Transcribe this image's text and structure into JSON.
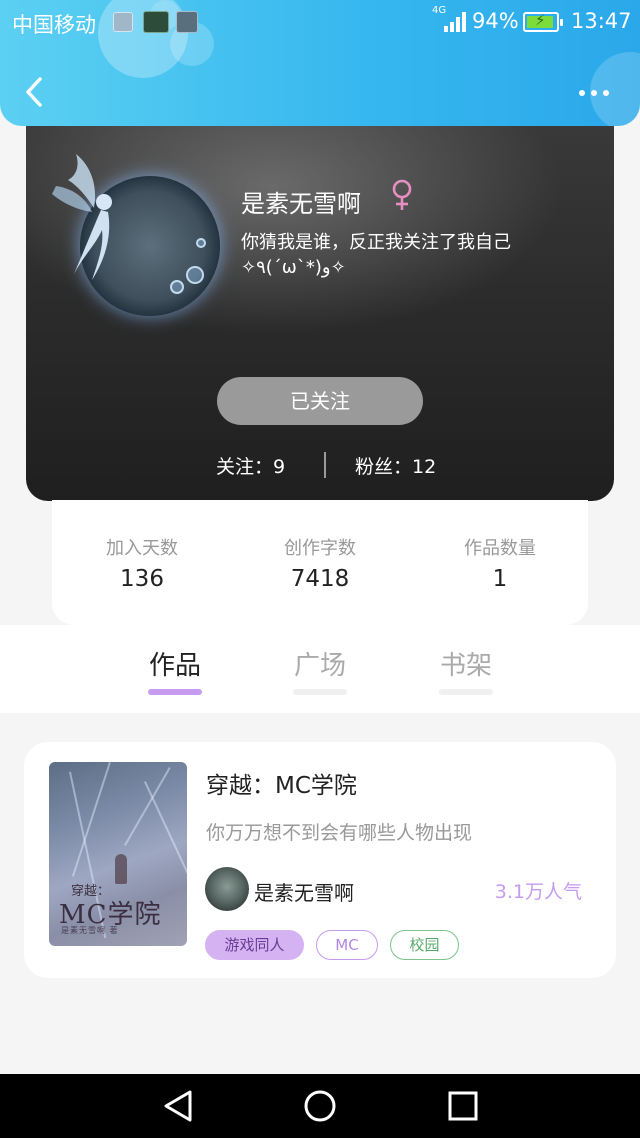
{
  "status_bar": {
    "carrier": "中国移动",
    "network": "4G",
    "battery": "94%",
    "battery_level": 0.94,
    "time": "13:47"
  },
  "header": {
    "back_icon": "chevron-left-icon",
    "more_icon": "more-horizontal-icon"
  },
  "profile": {
    "username": "是素无雪啊",
    "gender_icon": "female-icon",
    "bio": "你猜我是谁，反正我关注了我自己✧٩(ˊωˋ*)و✧",
    "follow_button_label": "已关注",
    "following_label": "关注：9",
    "fans_label": "粉丝：12"
  },
  "stats": [
    {
      "label": "加入天数",
      "value": "136"
    },
    {
      "label": "创作字数",
      "value": "7418"
    },
    {
      "label": "作品数量",
      "value": "1"
    }
  ],
  "tabs": [
    {
      "label": "作品",
      "active": true
    },
    {
      "label": "广场",
      "active": false
    },
    {
      "label": "书架",
      "active": false
    }
  ],
  "work": {
    "cover_small_title": "穿越：",
    "cover_title": "MC学院",
    "cover_subtitle": "是素无雪啊 著",
    "title": "穿越：MC学院",
    "description": "你万万想不到会有哪些人物出现",
    "author": "是素无雪啊",
    "popularity": "3.1万人气",
    "tags": [
      "游戏同人",
      "MC",
      "校园"
    ]
  },
  "colors": {
    "header_blue": "#37b8ef",
    "accent_purple": "#c79bf0",
    "tag_green": "#59a86b"
  },
  "nav_bar": {
    "back_icon": "triangle-back-icon",
    "home_icon": "circle-home-icon",
    "recent_icon": "square-recents-icon"
  }
}
